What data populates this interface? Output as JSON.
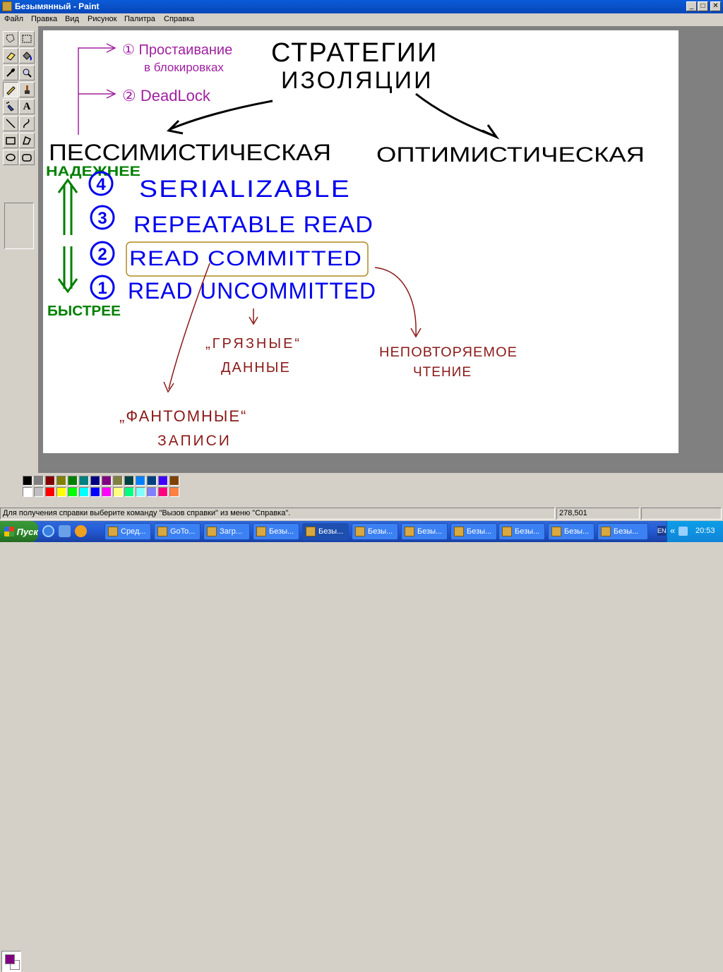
{
  "window": {
    "title": "Безымянный - Paint",
    "controls": {
      "minimize": "_",
      "maximize": "□",
      "close": "✕"
    }
  },
  "menu": [
    "Файл",
    "Правка",
    "Вид",
    "Рисунок",
    "Палитра",
    "Справка"
  ],
  "tools": [
    "free-select",
    "select",
    "eraser",
    "fill",
    "color-picker",
    "magnifier",
    "pencil",
    "brush",
    "airbrush",
    "text",
    "line",
    "curve",
    "rectangle",
    "polygon",
    "ellipse",
    "rounded-rectangle"
  ],
  "drawing": {
    "heading_line1": "СТРАТЕГИИ",
    "heading_line2": "ИЗОЛЯЦИИ",
    "note1": "① Простаивание",
    "note1b": "в блокировках",
    "note2": "② DeadLock",
    "left_branch": "ПЕССИМИСТИЧЕСКАЯ",
    "right_branch": "ОПТИМИСТИЧЕСКАЯ",
    "more_reliable": "НАДЕЖНЕЕ",
    "faster": "БЫСТРЕЕ",
    "levels": [
      {
        "num": "4",
        "name": "SERIALIZABLE"
      },
      {
        "num": "3",
        "name": "REPEATABLE READ"
      },
      {
        "num": "2",
        "name": "READ COMMITTED"
      },
      {
        "num": "1",
        "name": "READ UNCOMMITTED"
      }
    ],
    "dirty_data_line1": "„ГРЯЗНЫЕ“",
    "dirty_data_line2": "ДАННЫЕ",
    "nonrepeatable_line1": "НЕПОВТОРЯЕМОЕ",
    "nonrepeatable_line2": "ЧТЕНИЕ",
    "phantom_line1": "„ФАНТОМНЫЕ“",
    "phantom_line2": "ЗАПИСИ",
    "colors": {
      "black": "#000000",
      "purple": "#a020a0",
      "blue": "#0000ee",
      "green": "#008000",
      "brown": "#8b1a1a",
      "box": "#b08a20"
    }
  },
  "palette": {
    "foreground": "#800080",
    "background": "#ffffff",
    "row1": [
      "#000000",
      "#808080",
      "#800000",
      "#808000",
      "#008000",
      "#008080",
      "#000080",
      "#800080",
      "#808040",
      "#004040",
      "#0080ff",
      "#004080",
      "#4000ff",
      "#804000"
    ],
    "row2": [
      "#ffffff",
      "#c0c0c0",
      "#ff0000",
      "#ffff00",
      "#00ff00",
      "#00ffff",
      "#0000ff",
      "#ff00ff",
      "#ffff80",
      "#00ff80",
      "#80ffff",
      "#8080ff",
      "#ff0080",
      "#ff8040"
    ]
  },
  "status": {
    "help_text": "Для получения справки выберите команду \"Вызов справки\" из меню \"Справка\".",
    "coords": "278,501"
  },
  "taskbar": {
    "start": "Пуск",
    "tasks": [
      "Сред...",
      "GoTo...",
      "Загр...",
      "Безы...",
      "Безы...",
      "Безы...",
      "Безы...",
      "Безы...",
      "Безы...",
      "Безы...",
      "Безы..."
    ],
    "lang": "EN",
    "time": "20:53"
  }
}
